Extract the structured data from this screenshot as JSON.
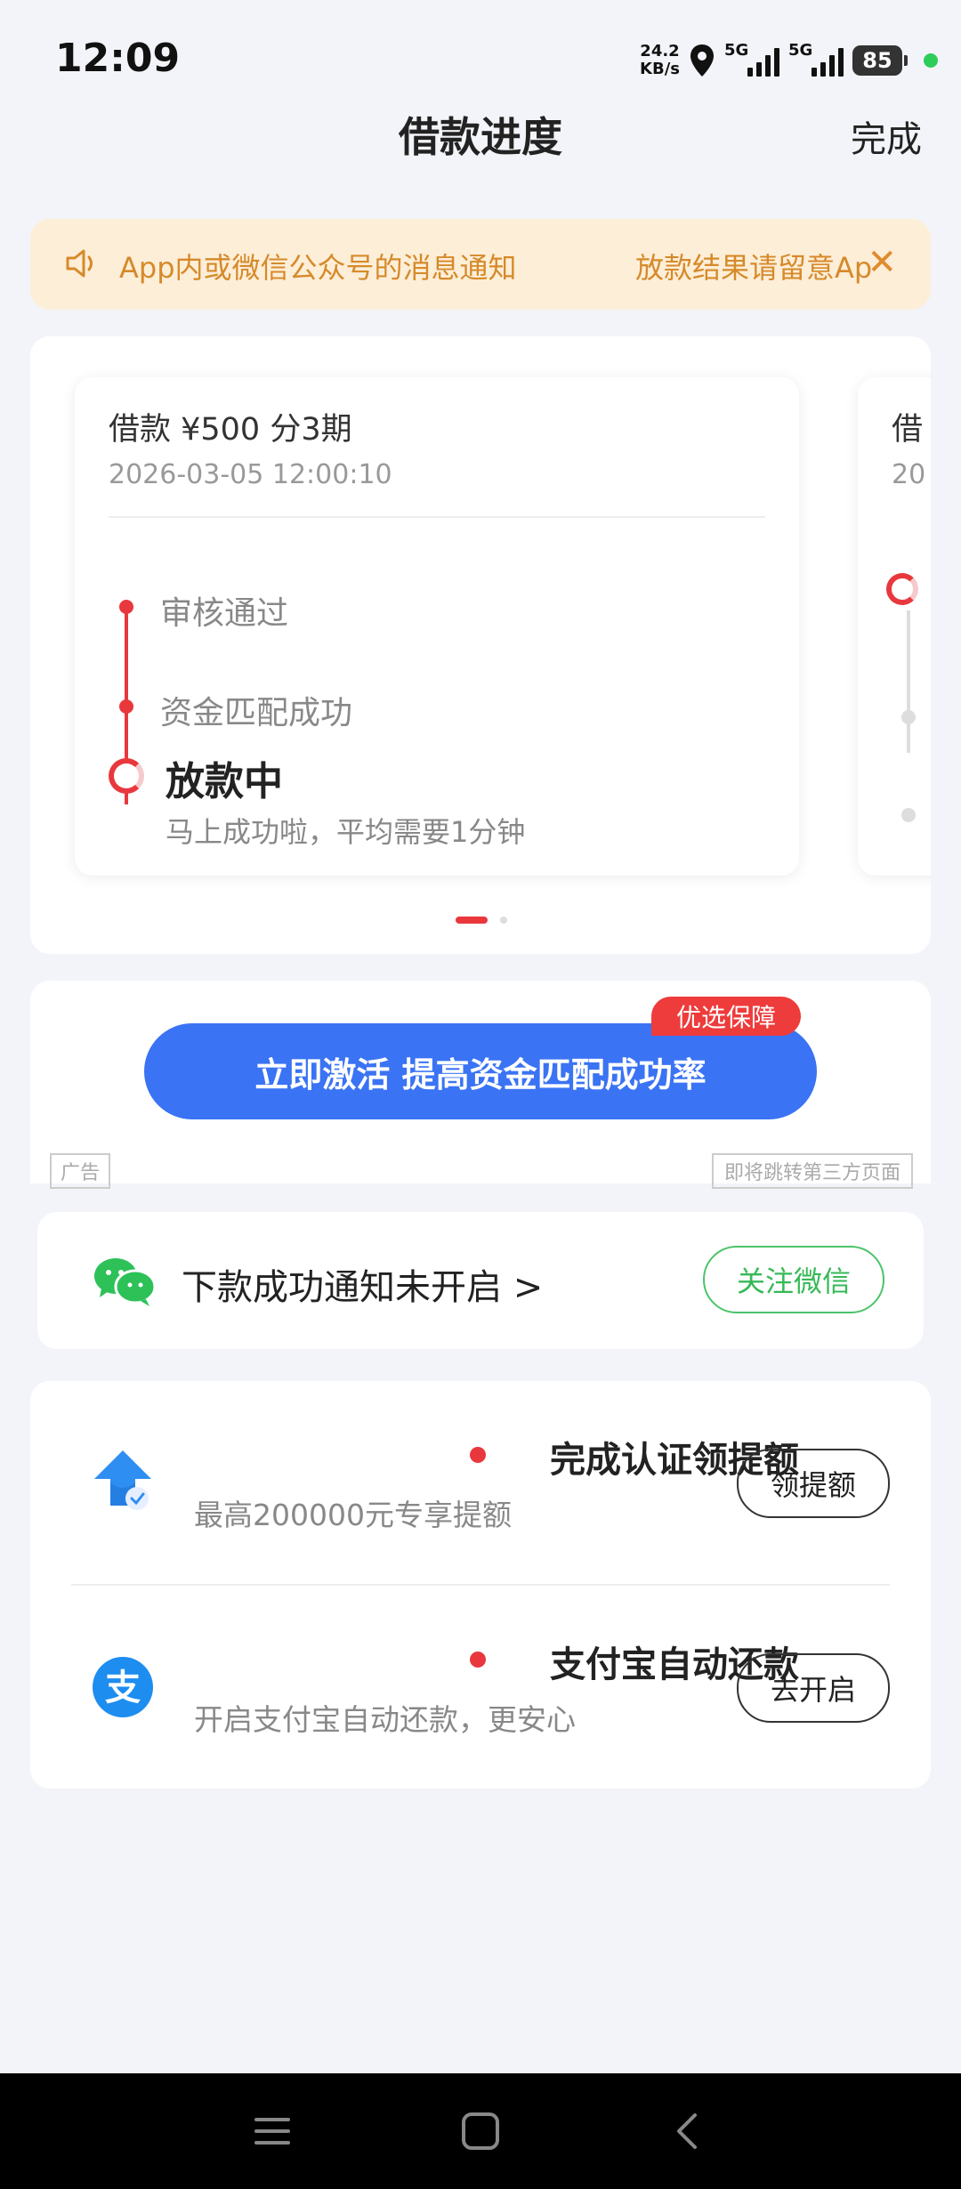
{
  "status_bar": {
    "time": "12:09",
    "net_speed_value": "24.2",
    "net_speed_unit": "KB/s",
    "sim1_label": "5G",
    "sim2_label": "5G",
    "battery": "85"
  },
  "header": {
    "title": "借款进度",
    "done_label": "完成"
  },
  "notice": {
    "text_1": "App内或微信公众号的消息通知",
    "text_2": "放款结果请留意Ap",
    "icon": "speaker-icon",
    "close_icon": "close-icon"
  },
  "loan_progress": {
    "card": {
      "summary": "借款 ¥500  分3期",
      "date": "2026-03-05 12:00:10",
      "steps": [
        {
          "label": "审核通过",
          "state": "done"
        },
        {
          "label": "资金匹配成功",
          "state": "done"
        },
        {
          "label": "放款中",
          "state": "current"
        }
      ],
      "current_hint": "马上成功啦，平均需要1分钟"
    },
    "next_card_peek": {
      "summary": "借",
      "date": "20"
    },
    "pager": {
      "current": 1,
      "total": 2
    }
  },
  "ad": {
    "tag": "优选保障",
    "button_label": "立即激活 提高资金匹配成功率",
    "ad_label": "广告",
    "jump_hint": "即将跳转第三方页面"
  },
  "wechat_notice": {
    "text": "下款成功通知未开启 >",
    "button_label": "关注微信",
    "icon": "wechat-icon"
  },
  "tasks": [
    {
      "title": "完成认证领提额",
      "subtitle": "最高200000元专享提额",
      "button_label": "领提额",
      "icon": "upgrade-arrow-icon"
    },
    {
      "title": "支付宝自动还款",
      "subtitle": "开启支付宝自动还款，更安心",
      "button_label": "去开启",
      "icon": "alipay-icon"
    }
  ],
  "nav_bar": {
    "items": [
      "menu-icon",
      "home-icon",
      "back-icon"
    ]
  },
  "colors": {
    "accent_red": "#e8383d",
    "primary_blue": "#3a73f4",
    "notice_bg": "#fdeed8",
    "notice_text": "#d68a2a",
    "wechat_green": "#36b957",
    "page_bg": "#f3f4f9"
  }
}
